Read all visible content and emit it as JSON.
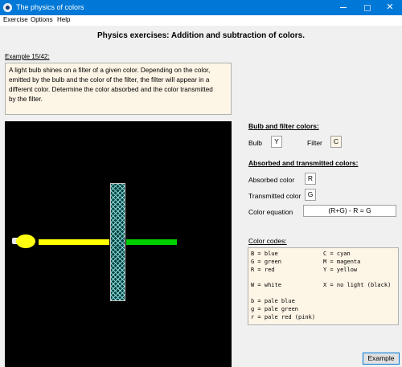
{
  "window": {
    "title": "The physics of colors"
  },
  "menu": {
    "items": [
      "Exercise",
      "Options",
      "Help"
    ]
  },
  "page": {
    "title": "Physics exercises: Addition and subtraction of colors."
  },
  "example": {
    "label": "Example 15/42:",
    "question_lines": [
      "A light  bulb shines on a filter of a given color.  Depending on the color,",
      "emitted by the  bulb and the color of the filter,  the filter will appear in a",
      "different color. Determine the color absorbed and the color transmitted",
      "by the filter."
    ]
  },
  "scene": {
    "bulb_color": "#ffff10",
    "incoming_beam_color": "#ffff00",
    "filter_color": "#00ffff",
    "transmitted_beam_color": "#00d000"
  },
  "bulb_filter": {
    "title": "Bulb and filter colors:",
    "bulb_label": "Bulb",
    "bulb_value": "Y",
    "filter_label": "Filter",
    "filter_value": "C"
  },
  "absorbed_transmitted": {
    "title": "Absorbed and transmitted colors:",
    "absorbed_label": "Absorbed color",
    "absorbed_value": "R",
    "transmitted_label": "Transmitted color",
    "transmitted_value": "G",
    "equation_label": "Color equation",
    "equation_value": "(R+G) - R = G"
  },
  "color_codes": {
    "label": "Color codes:",
    "entries": [
      "B = blue",
      "C = cyan",
      "G = green",
      "M = magenta",
      "R = red",
      "Y = yellow",
      "W = white",
      "X = no light (black)",
      "b = pale blue",
      "g = pale green",
      "r = pale red (pink)"
    ]
  },
  "buttons": {
    "example": "Example"
  },
  "icons": {
    "app": "app-icon",
    "minimize": "minimize-icon",
    "maximize": "maximize-icon",
    "close": "close-icon"
  }
}
